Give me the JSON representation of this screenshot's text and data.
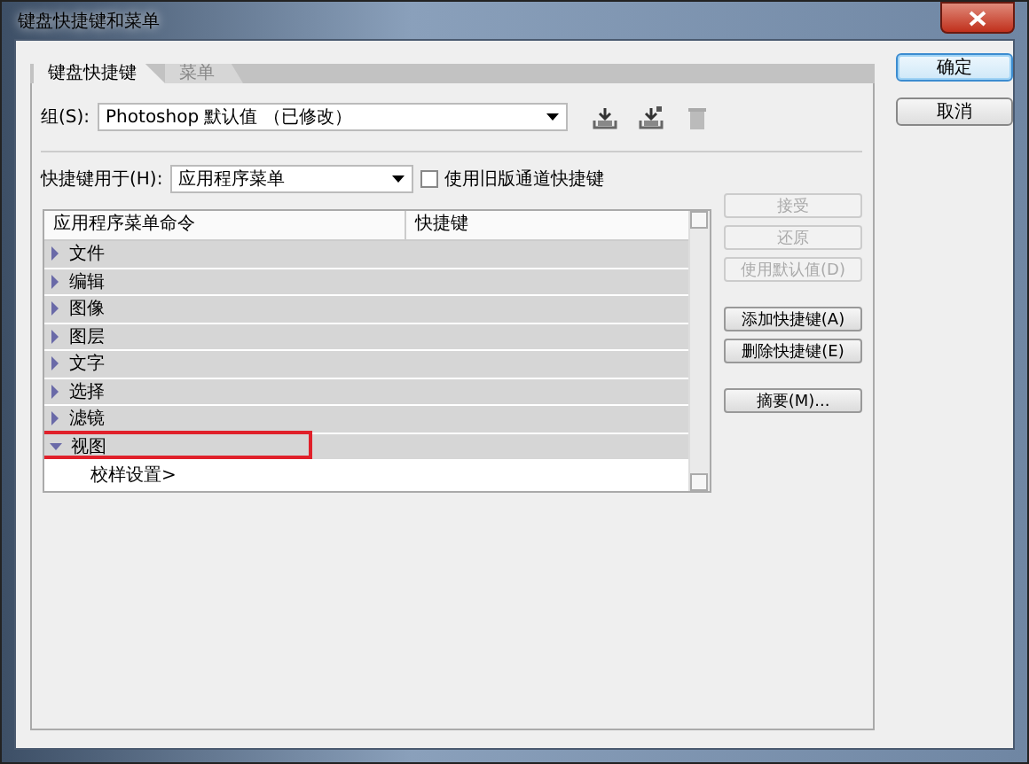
{
  "window": {
    "title": "键盘快捷键和菜单"
  },
  "dialog_buttons": [
    {
      "label": "确定",
      "default": true
    },
    {
      "label": "取消",
      "default": false
    }
  ],
  "tabs": [
    {
      "label": "键盘快捷键",
      "selected": true
    },
    {
      "label": "菜单",
      "selected": false
    }
  ],
  "set": {
    "label": "组(S):",
    "value": "Photoshop 默认值 （已修改）"
  },
  "shortcuts_for": {
    "label": "快捷键用于(H):",
    "value": "应用程序菜单"
  },
  "legacy_checkbox": {
    "label": "使用旧版通道快捷键",
    "checked": false
  },
  "tree": {
    "columns": [
      "应用程序菜单命令",
      "快捷键"
    ],
    "items": [
      {
        "label": "文件",
        "expanded": false,
        "highlighted": false
      },
      {
        "label": "编辑",
        "expanded": false,
        "highlighted": false
      },
      {
        "label": "图像",
        "expanded": false,
        "highlighted": false
      },
      {
        "label": "图层",
        "expanded": false,
        "highlighted": false
      },
      {
        "label": "文字",
        "expanded": false,
        "highlighted": false
      },
      {
        "label": "选择",
        "expanded": false,
        "highlighted": false
      },
      {
        "label": "滤镜",
        "expanded": false,
        "highlighted": false
      },
      {
        "label": "视图",
        "expanded": true,
        "highlighted": true,
        "children": [
          {
            "label": "校样设置>"
          }
        ]
      }
    ]
  },
  "side_buttons": [
    {
      "label": "接受",
      "disabled": true
    },
    {
      "label": "还原",
      "disabled": true
    },
    {
      "label": "使用默认值(D)",
      "disabled": true
    },
    {
      "label": "添加快捷键(A)",
      "disabled": false
    },
    {
      "label": "删除快捷键(E)",
      "disabled": false
    },
    {
      "label": "摘要(M)...",
      "disabled": false
    }
  ]
}
